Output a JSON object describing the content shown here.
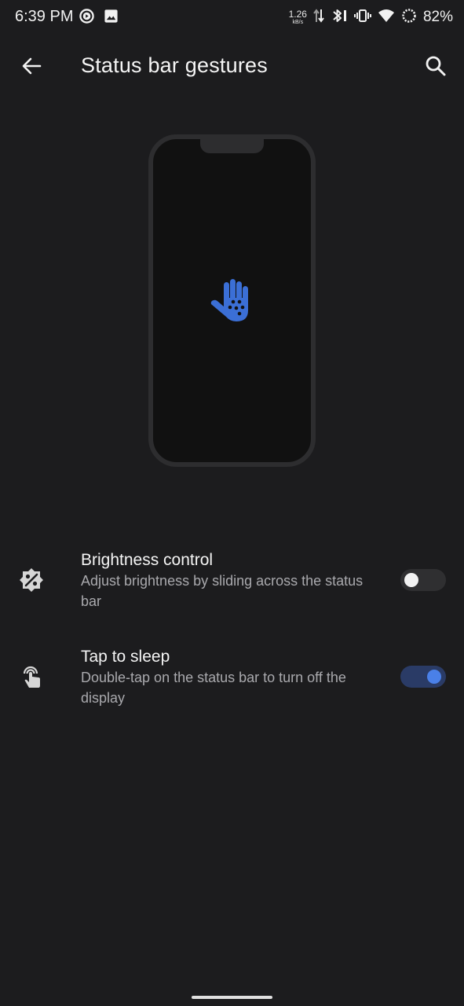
{
  "status_bar": {
    "time": "6:39 PM",
    "net_speed_value": "1.26",
    "net_speed_unit": "kB/s",
    "battery_percent": "82%",
    "icons": [
      "media-play-icon",
      "image-icon",
      "data-updown-icon",
      "bluetooth-icon",
      "vibrate-icon",
      "wifi-icon",
      "battery-saver-icon"
    ]
  },
  "toolbar": {
    "title": "Status bar gestures",
    "back_icon": "arrow-back-icon",
    "search_icon": "search-icon"
  },
  "illustration": {
    "icon": "hand-icon",
    "accent_color": "#3b6fd6"
  },
  "settings": [
    {
      "title": "Brightness control",
      "summary": "Adjust brightness by sliding across the status bar",
      "icon": "brightness-icon",
      "enabled": false
    },
    {
      "title": "Tap to sleep",
      "summary": "Double-tap on the status bar to turn off the display",
      "icon": "touch-icon",
      "enabled": true
    }
  ],
  "colors": {
    "background": "#1c1c1e",
    "switch_on_track": "#2a3b66",
    "switch_on_thumb": "#4a80e8",
    "switch_off_track": "#2f2f31",
    "switch_off_thumb": "#f2f2f2"
  }
}
